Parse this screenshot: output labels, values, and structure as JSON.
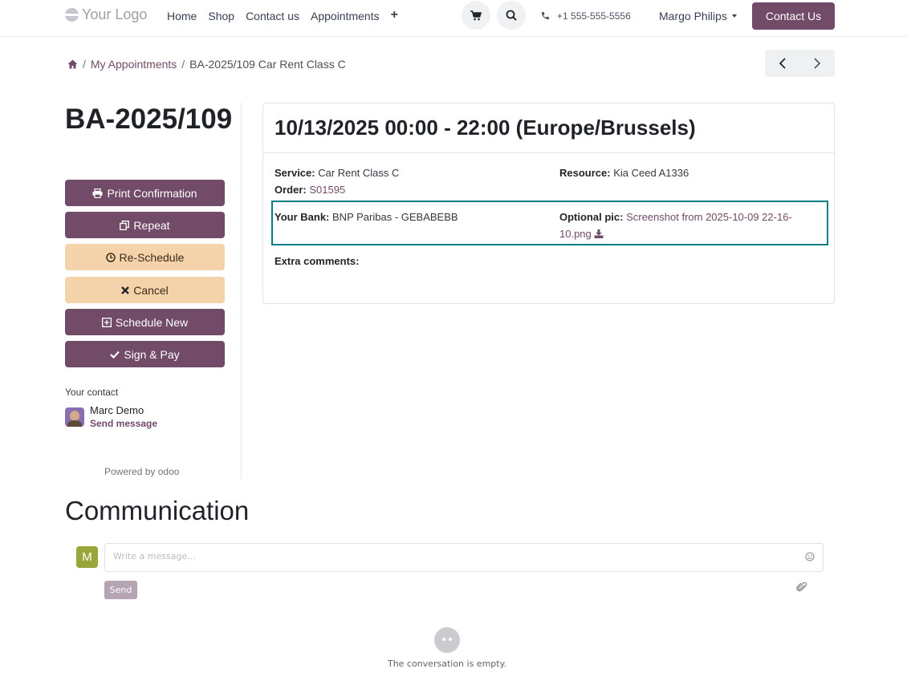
{
  "header": {
    "logo_text": "Your Logo",
    "nav": [
      {
        "label": "Home"
      },
      {
        "label": "Shop"
      },
      {
        "label": "Contact us"
      },
      {
        "label": "Appointments"
      },
      {
        "label": "+"
      }
    ],
    "phone": "+1 555-555-5556",
    "user_name": "Margo Philips",
    "contact_button": "Contact Us"
  },
  "breadcrumb": {
    "items": [
      {
        "label": "My Appointments"
      },
      {
        "label": "BA-2025/109 Car Rent Class C"
      }
    ]
  },
  "sidebar": {
    "title": "BA-2025/109",
    "actions": [
      {
        "label": "Print Confirmation",
        "icon": "print-icon",
        "style": "primary"
      },
      {
        "label": "Repeat",
        "icon": "copy-icon",
        "style": "primary"
      },
      {
        "label": "Re-Schedule",
        "icon": "clock-icon",
        "style": "warning"
      },
      {
        "label": "Cancel",
        "icon": "times-icon",
        "style": "warning"
      },
      {
        "label": "Schedule New",
        "icon": "plus-square-icon",
        "style": "primary"
      },
      {
        "label": "Sign & Pay",
        "icon": "check-icon",
        "style": "primary"
      }
    ],
    "contact_label": "Your contact",
    "contact_name": "Marc Demo",
    "send_message": "Send message",
    "powered_by": "Powered by",
    "powered_brand": "odoo"
  },
  "card": {
    "title": "10/13/2025 00:00 - 22:00 (Europe/Brussels)",
    "service_label": "Service:",
    "service_value": "Car Rent Class C",
    "resource_label": "Resource:",
    "resource_value": "Kia Ceed A1336",
    "order_label": "Order:",
    "order_value": "S01595",
    "bank_label": "Your Bank:",
    "bank_value": "BNP Paribas - GEBABEBB",
    "pic_label": "Optional pic:",
    "pic_value_line1": "Screenshot from 2025-10-09 22-16-",
    "pic_value_line2": "10.png",
    "comments_label": "Extra comments:"
  },
  "communication": {
    "title": "Communication",
    "avatar_letter": "M",
    "placeholder": "Write a message...",
    "send_label": "Send",
    "empty_text": "The conversation is empty."
  },
  "colors": {
    "brand": "#714B67",
    "warning": "#f4d3ab",
    "highlight_border": "#017e84"
  }
}
